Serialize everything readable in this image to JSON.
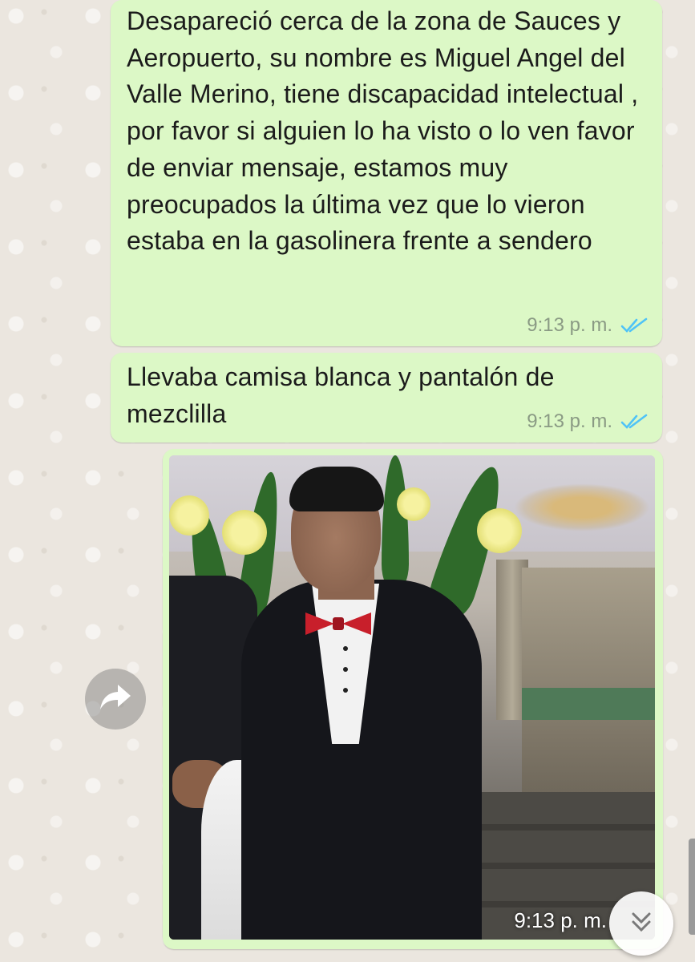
{
  "messages": [
    {
      "type": "text",
      "text": "Desapareció cerca de la zona de Sauces y Aeropuerto, su nombre es Miguel Angel del Valle Merino, tiene discapacidad intelectual , por favor si alguien lo ha visto o lo ven favor de enviar mensaje, estamos muy preocupados la última vez que lo vieron estaba en la gasolinera frente a sendero",
      "time": "9:13 p. m.",
      "status": "read"
    },
    {
      "type": "text",
      "text": "Llevaba camisa blanca y pantalón de mezclilla",
      "time": "9:13 p. m.",
      "status": "read"
    },
    {
      "type": "image",
      "time": "9:13 p. m.",
      "status": "read"
    }
  ],
  "controls": {
    "forward_icon": "forward-arrow-icon",
    "scroll_icon": "double-chevron-down-icon"
  },
  "colors": {
    "outgoing_bubble": "#dcf8c6",
    "read_ticks": "#4fc3f7",
    "wallpaper": "#ebe6df"
  }
}
